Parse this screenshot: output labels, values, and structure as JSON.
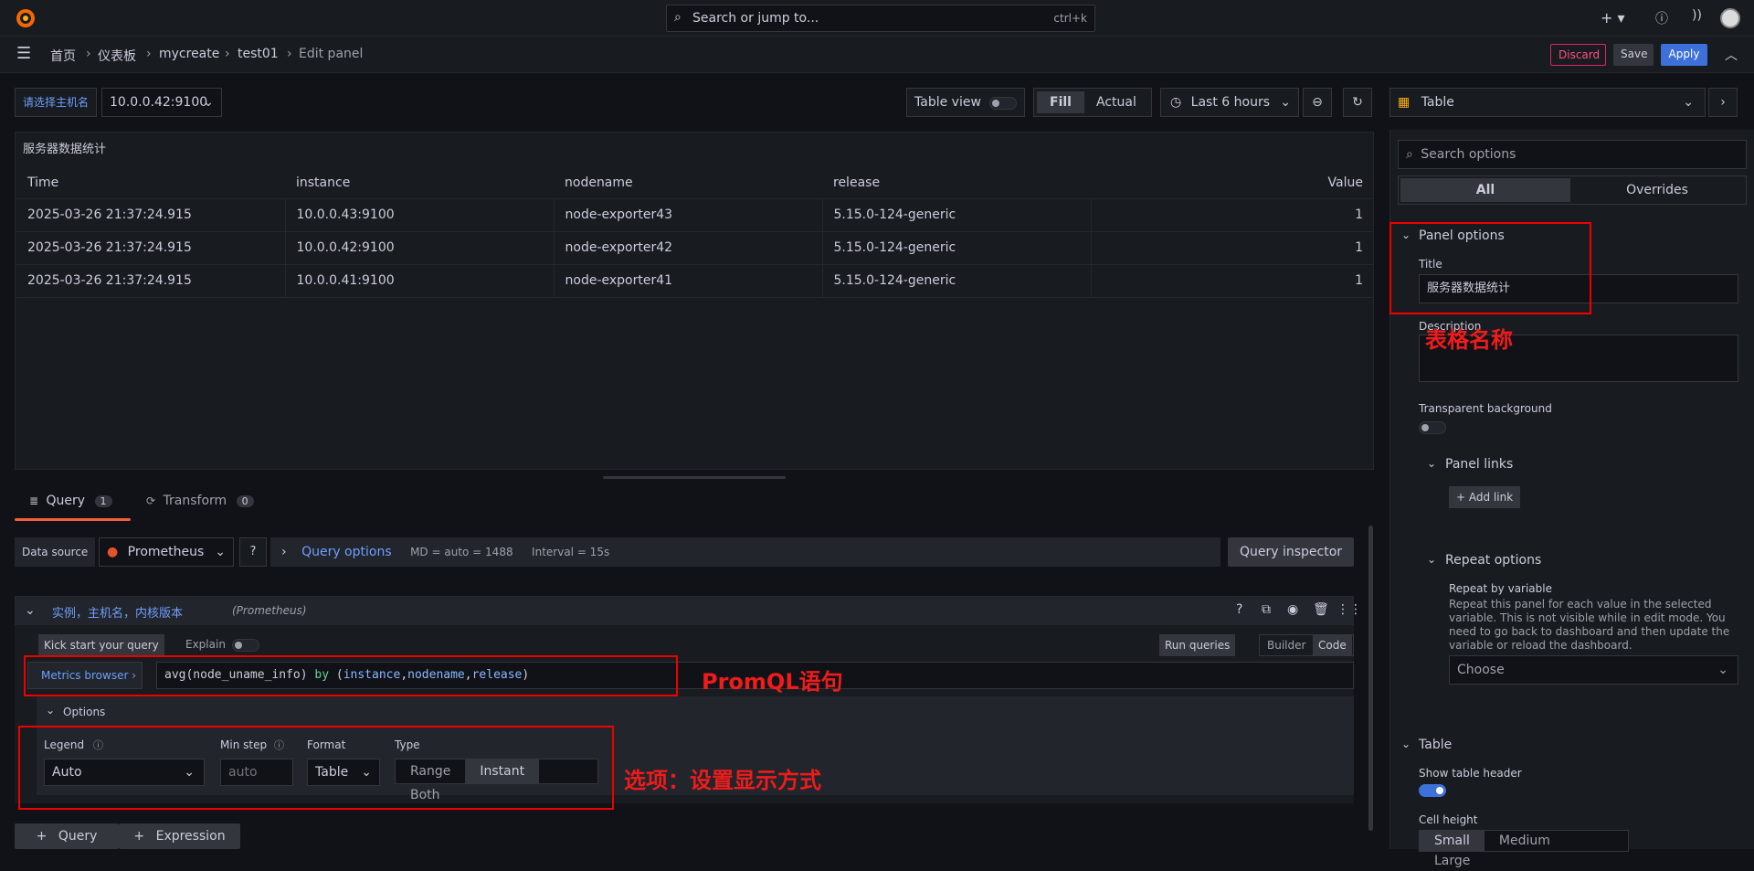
{
  "topbar": {
    "search_placeholder": "Search or jump to...",
    "search_shortcut": "ctrl+k"
  },
  "breadcrumb": [
    "首页",
    "仪表板",
    "mycreate",
    "test01",
    "Edit panel"
  ],
  "actions": {
    "discard": "Discard",
    "save": "Save",
    "apply": "Apply"
  },
  "variable": {
    "label": "请选择主机名",
    "value": "10.0.0.42:9100"
  },
  "toolbar": {
    "table_view": "Table view",
    "fill": "Fill",
    "actual": "Actual",
    "time_range": "Last 6 hours"
  },
  "panel": {
    "title": "服务器数据统计",
    "columns": [
      "Time",
      "instance",
      "nodename",
      "release",
      "Value"
    ],
    "rows": [
      [
        "2025-03-26 21:37:24.915",
        "10.0.0.43:9100",
        "node-exporter43",
        "5.15.0-124-generic",
        "1"
      ],
      [
        "2025-03-26 21:37:24.915",
        "10.0.0.42:9100",
        "node-exporter42",
        "5.15.0-124-generic",
        "1"
      ],
      [
        "2025-03-26 21:37:24.915",
        "10.0.0.41:9100",
        "node-exporter41",
        "5.15.0-124-generic",
        "1"
      ]
    ]
  },
  "tabs": {
    "query": "Query",
    "query_count": "1",
    "transform": "Transform",
    "transform_count": "0"
  },
  "datasource": {
    "label": "Data source",
    "name": "Prometheus",
    "query_options": "Query options",
    "md": "MD = auto = 1488",
    "interval": "Interval = 15s",
    "inspector": "Query inspector"
  },
  "query": {
    "name": "实例，主机名，内核版本",
    "ds": "(Prometheus)",
    "kick_start": "Kick start your query",
    "explain": "Explain",
    "run": "Run queries",
    "builder": "Builder",
    "code": "Code",
    "metrics_browser": "Metrics browser",
    "options": "Options",
    "legend_label": "Legend",
    "legend_value": "Auto",
    "min_step_label": "Min step",
    "min_step_placeholder": "auto",
    "format_label": "Format",
    "format_value": "Table",
    "type_label": "Type",
    "type_range": "Range",
    "type_instant": "Instant",
    "type_both": "Both"
  },
  "bottom_buttons": {
    "query": "Query",
    "expression": "Expression"
  },
  "annotations": {
    "title": "表格名称",
    "promql": "PromQL语句",
    "options": "选项：设置显示方式"
  },
  "right": {
    "viz": "Table",
    "search_placeholder": "Search options",
    "tab_all": "All",
    "tab_overrides": "Overrides",
    "panel_options": "Panel options",
    "title_label": "Title",
    "title_value": "服务器数据统计",
    "description_label": "Description",
    "transparent_label": "Transparent background",
    "panel_links": "Panel links",
    "add_link": "Add link",
    "repeat_options": "Repeat options",
    "repeat_by_label": "Repeat by variable",
    "repeat_desc": "Repeat this panel for each value in the selected variable. This is not visible while in edit mode. You need to go back to dashboard and then update the variable or reload the dashboard.",
    "choose": "Choose",
    "table_section": "Table",
    "show_header_label": "Show table header",
    "cell_height_label": "Cell height",
    "cell_small": "Small",
    "cell_medium": "Medium",
    "cell_large": "Large"
  }
}
